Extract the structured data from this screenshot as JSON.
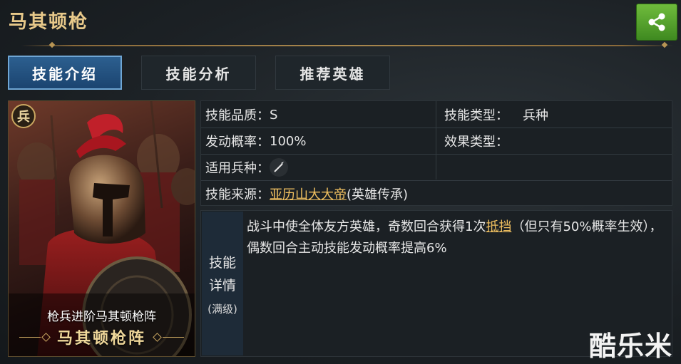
{
  "header": {
    "title": "马其顿枪"
  },
  "share": {
    "icon": "share-icon"
  },
  "tabs": [
    {
      "label": "技能介绍",
      "active": true
    },
    {
      "label": "技能分析",
      "active": false
    },
    {
      "label": "推荐英雄",
      "active": false
    }
  ],
  "card": {
    "badge": "兵",
    "subtitle": "枪兵进阶马其顿枪阵",
    "name": "马其顿枪阵"
  },
  "info": {
    "quality_label": "技能品质：",
    "quality_value": "S",
    "type_label": "技能类型：",
    "type_value": "兵种",
    "rate_label": "发动概率：",
    "rate_value": "100%",
    "effect_label": "效果类型：",
    "effect_value": "",
    "troop_label": "适用兵种：",
    "troop_icon": "spear-icon",
    "source_label": "技能来源：",
    "source_link": "亚历山大大帝",
    "source_suffix": "(英雄传承)"
  },
  "detail": {
    "side_line1": "技能",
    "side_line2": "详情",
    "side_small": "(满级)",
    "text_before": "战斗中使全体友方英雄，奇数回合获得1次",
    "text_link": "抵挡",
    "text_after": "（但只有50%概率生效），偶数回合主动技能发动概率提高6%"
  },
  "watermark": "酷乐米",
  "colors": {
    "accent_gold": "#e8c98a",
    "tab_active": "#2c5f8f",
    "share_green": "#5aa52e",
    "link": "#f0c060"
  }
}
